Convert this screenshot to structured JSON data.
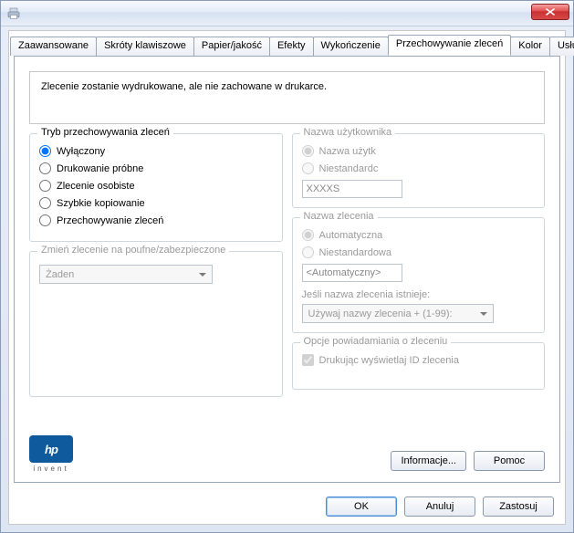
{
  "tabs": {
    "advanced": "Zaawansowane",
    "shortcuts": "Skróty klawiszowe",
    "paper": "Papier/jakość",
    "effects": "Efekty",
    "finishing": "Wykończenie",
    "storage": "Przechowywanie zleceń",
    "color": "Kolor",
    "services": "Usługi"
  },
  "info_text": "Zlecenie zostanie wydrukowane, ale nie zachowane w drukarce.",
  "storage_mode": {
    "title": "Tryb przechowywania zleceń",
    "off": "Wyłączony",
    "proof": "Drukowanie próbne",
    "personal": "Zlecenie osobiste",
    "quick": "Szybkie kopiowanie",
    "store": "Przechowywanie zleceń"
  },
  "secure": {
    "title": "Zmień zlecenie na poufne/zabezpieczone",
    "value": "Żaden"
  },
  "user": {
    "title": "Nazwa użytkownika",
    "auto": "Nazwa użytk",
    "custom": "Niestandardc",
    "value": "XXXXS"
  },
  "jobname": {
    "title": "Nazwa zlecenia",
    "auto": "Automatyczna",
    "custom": "Niestandardowa",
    "value": "<Automatyczny>",
    "exists_label": "Jeśli nazwa zlecenia istnieje:",
    "exists_value": "Używaj nazwy zlecenia + (1-99):"
  },
  "notify": {
    "title": "Opcje powiadamiania o zleceniu",
    "checkbox": "Drukując wyświetlaj ID zlecenia"
  },
  "logo_sub": "invent",
  "logo_text": "hp",
  "buttons": {
    "info": "Informacje...",
    "help": "Pomoc",
    "ok": "OK",
    "cancel": "Anuluj",
    "apply": "Zastosuj"
  }
}
